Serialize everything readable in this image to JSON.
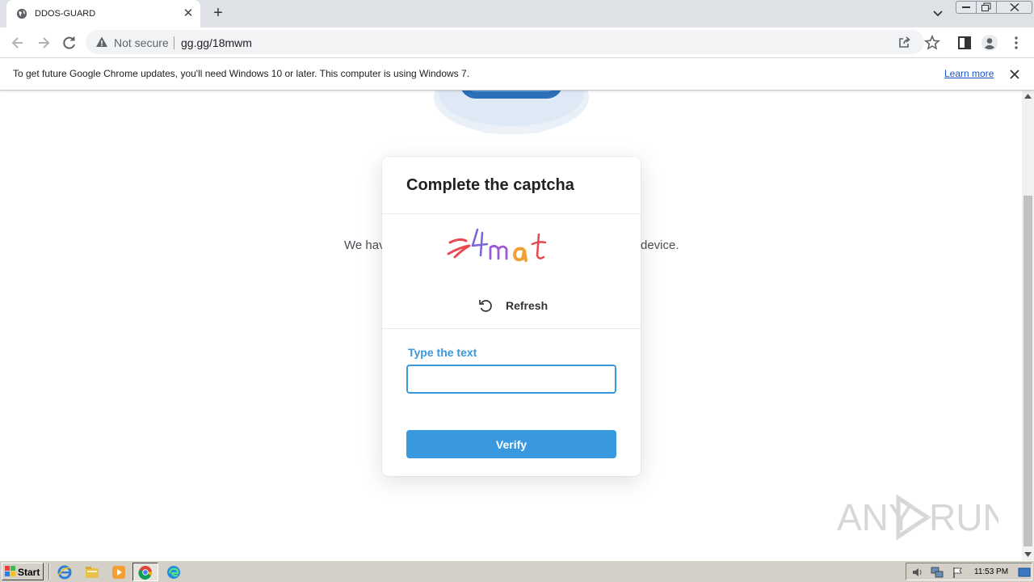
{
  "browser": {
    "tab_title": "DDOS-GUARD",
    "new_tab": "+",
    "tab_close": "✕",
    "security_label": "Not secure",
    "url": "gg.gg/18mwm"
  },
  "infobar": {
    "message": "To get future Google Chrome updates, you'll need Windows 10 or later. This computer is using Windows 7.",
    "link": "Learn more"
  },
  "page": {
    "bg_text_left": "We hav",
    "bg_text_right": "device."
  },
  "captcha": {
    "heading": "Complete the captcha",
    "refresh_label": "Refresh",
    "field_label": "Type the text",
    "field_value": "",
    "verify_label": "Verify",
    "accent_color": "#3898e0"
  },
  "taskbar": {
    "start_label": "Start",
    "clock": "11:53 PM"
  },
  "watermark": {
    "text_left": "ANY",
    "text_right": "RUN"
  },
  "icons": [
    "globe-icon",
    "warning-icon",
    "back-icon",
    "forward-icon",
    "reload-icon",
    "share-icon",
    "star-icon",
    "side-panel-icon",
    "profile-icon",
    "menu-icon",
    "refresh-icon",
    "ie-icon",
    "explorer-icon",
    "media-player-icon",
    "chrome-icon",
    "edge-icon"
  ]
}
